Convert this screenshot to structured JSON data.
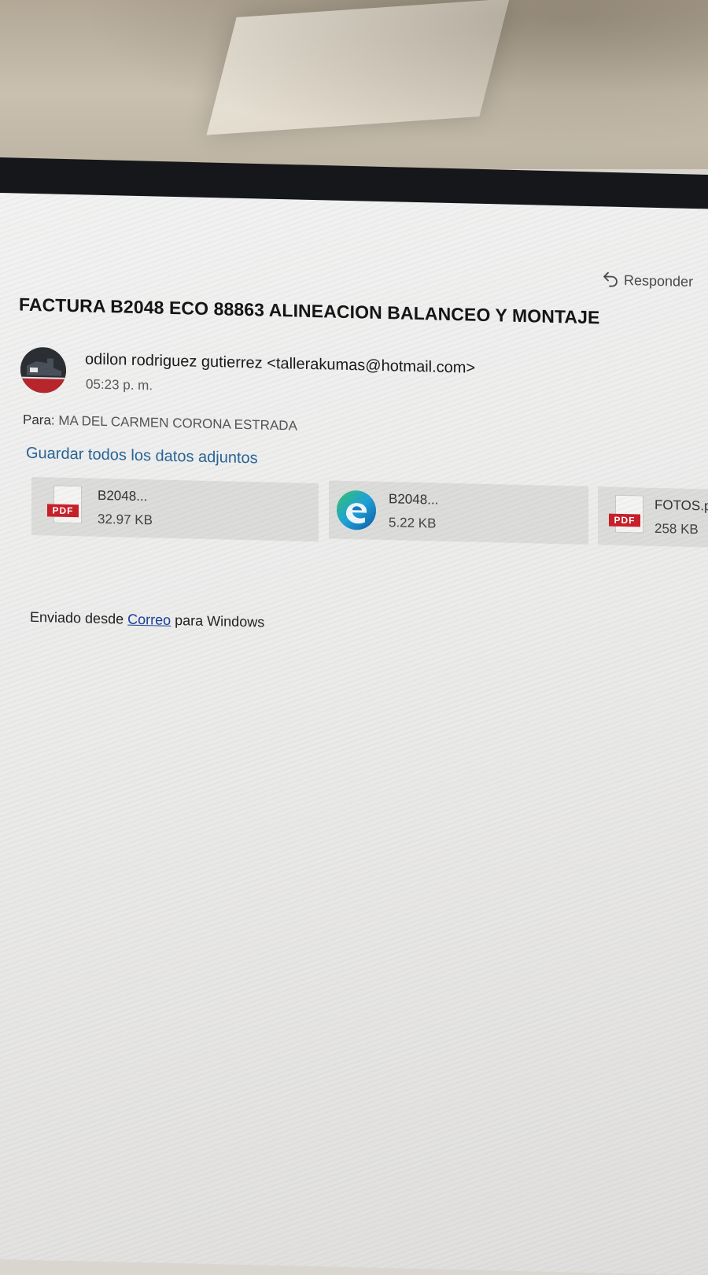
{
  "email": {
    "reply_label": "Responder",
    "subject": "FACTURA B2048 ECO 88863 ALINEACION BALANCEO Y MONTAJE",
    "sender_name": "odilon rodriguez gutierrez",
    "sender_email": "<tallerakumas@hotmail.com>",
    "time": "05:23 p. m.",
    "to_label": "Para:",
    "to_value": "MA DEL CARMEN CORONA ESTRADA",
    "save_all_label": "Guardar todos los datos adjuntos",
    "attachments": [
      {
        "icon": "pdf-icon",
        "badge": "PDF",
        "name": "B2048...",
        "size": "32.97 KB"
      },
      {
        "icon": "edge-browser-icon",
        "name": "B2048...",
        "size": "5.22 KB"
      },
      {
        "icon": "pdf-icon",
        "badge": "PDF",
        "name": "FOTOS.p",
        "size": "258 KB"
      }
    ],
    "footer": {
      "prefix": "Enviado desde",
      "link": "Correo",
      "suffix": "para Windows"
    }
  },
  "colors": {
    "link": "#2a6496",
    "pdf_badge": "#c8202a",
    "bezel": "#15171a"
  }
}
